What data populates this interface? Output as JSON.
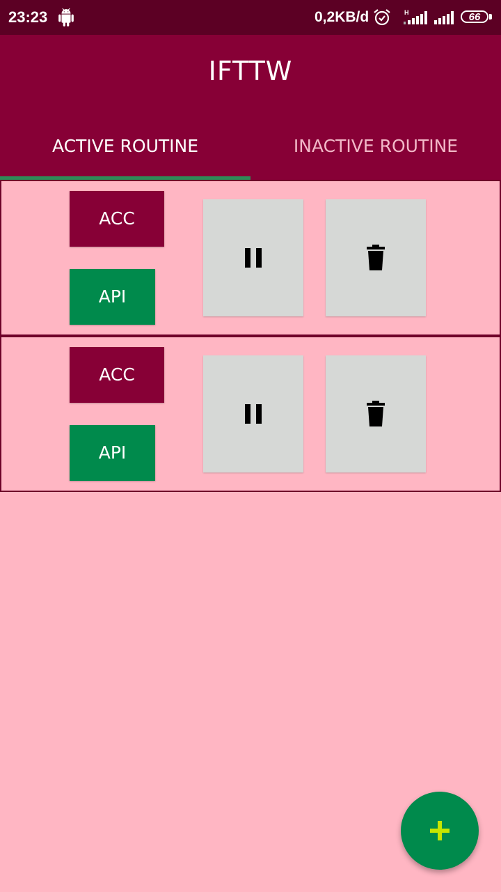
{
  "status_bar": {
    "time": "23:23",
    "net_speed": "0,2KB/d",
    "battery_level": "66",
    "icons": [
      "android-icon",
      "alarm-icon",
      "signal-h-icon",
      "signal-icon",
      "battery-icon"
    ]
  },
  "app_bar": {
    "title": "IFTTW"
  },
  "tabs": [
    {
      "label": "ACTIVE ROUTINE",
      "selected": true
    },
    {
      "label": "INACTIVE ROUTINE",
      "selected": false
    }
  ],
  "routines": [
    {
      "acc_label": "ACC",
      "api_label": "API",
      "pause_icon": "pause-icon",
      "delete_icon": "trash-icon"
    },
    {
      "acc_label": "ACC",
      "api_label": "API",
      "pause_icon": "pause-icon",
      "delete_icon": "trash-icon"
    }
  ],
  "fab": {
    "icon": "plus-icon"
  },
  "colors": {
    "status_bar": "#5c0024",
    "app_bar": "#870036",
    "background": "#ffb6c3",
    "acc_button": "#870036",
    "api_button": "#008a4c",
    "tab_indicator": "#2f8a57",
    "fab": "#008a4c",
    "fab_icon": "#c6e600"
  }
}
